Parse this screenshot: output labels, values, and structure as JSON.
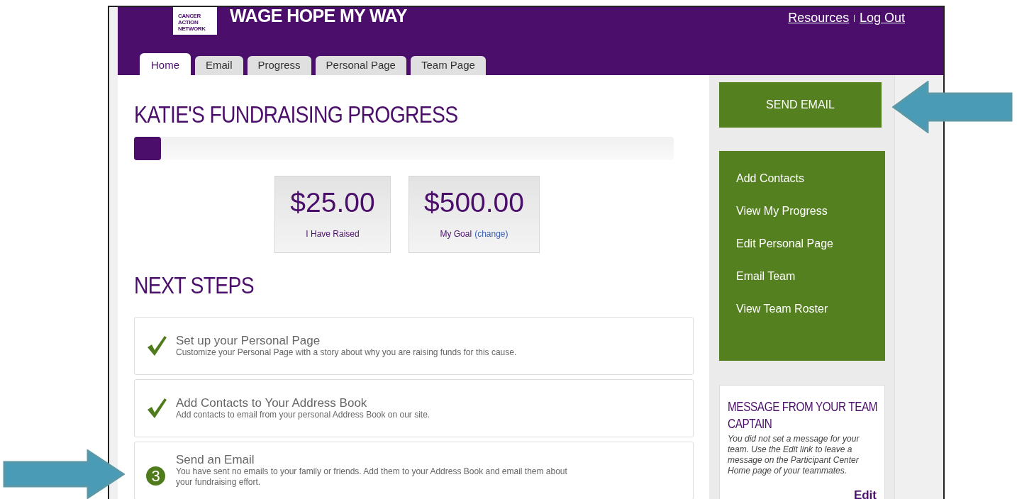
{
  "header": {
    "logo_lines": [
      "CANCER",
      "ACTION",
      "NETWORK"
    ],
    "title": "WAGE HOPE MY WAY",
    "links": [
      "Resources",
      "Log Out"
    ],
    "separator": "|"
  },
  "tabs": [
    {
      "label": "Home",
      "selected": true
    },
    {
      "label": "Email",
      "selected": false
    },
    {
      "label": "Progress",
      "selected": false
    },
    {
      "label": "Personal Page",
      "selected": false
    },
    {
      "label": "Team Page",
      "selected": false
    }
  ],
  "progress": {
    "title": "KATIE'S FUNDRAISING PROGRESS",
    "level": 0.05,
    "stats": [
      {
        "amount": "$25.00",
        "label": "I Have Raised"
      },
      {
        "amount": "$500.00",
        "label": "My Goal",
        "link": "(change)"
      }
    ]
  },
  "next_steps": {
    "title": "NEXT STEPS",
    "steps": [
      {
        "title": "Set up your Personal Page",
        "description": "Customize your Personal Page with a story about why you are raising funds for this cause.",
        "completed": true
      },
      {
        "title": "Add Contacts to Your Address Book",
        "description": "Add contacts to email from your personal Address Book on our site.",
        "completed": true
      },
      {
        "title": "Send an Email",
        "description": "You have sent no emails to your family or friends. Add them to your Address Book and email them about your fundraising effort.",
        "completed": false,
        "number": "3"
      }
    ]
  },
  "sidebar": {
    "primary_button": "SEND EMAIL",
    "links": [
      "Add Contacts",
      "View My Progress",
      "Edit Personal Page",
      "Email Team",
      "View Team Roster"
    ],
    "message_card": {
      "title": "MESSAGE FROM YOUR TEAM CAPTAIN",
      "body": "You did not set a message for your team. Use the Edit link to leave a message on the Participant Center Home page of your teammates.",
      "action": "Edit"
    }
  }
}
